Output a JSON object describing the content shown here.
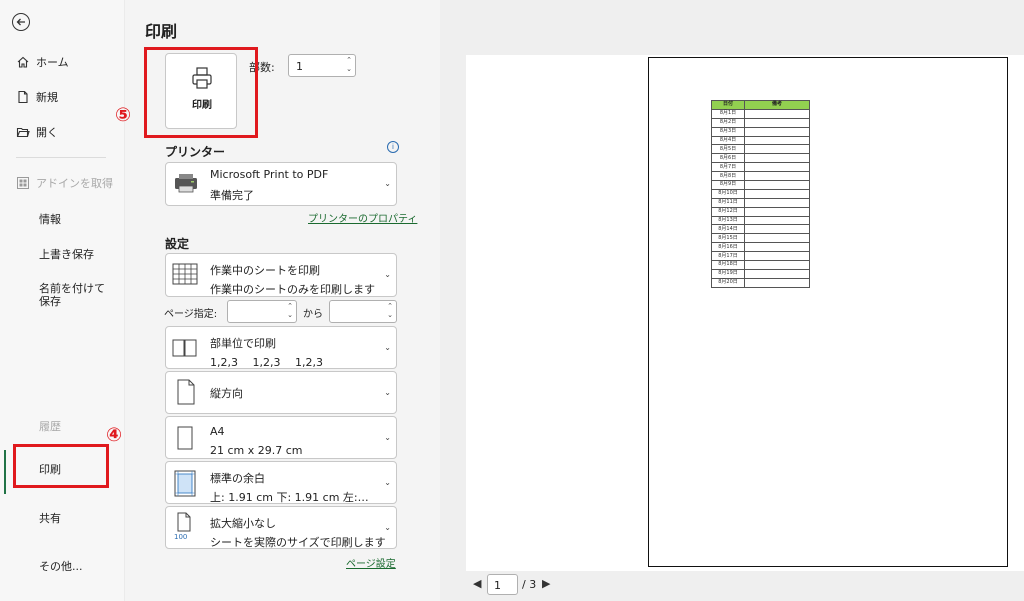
{
  "nav": {
    "home": "ホーム",
    "new": "新規",
    "open": "開く",
    "addins": "アドインを取得",
    "info": "情報",
    "save": "上書き保存",
    "save_as": "名前を付けて保存",
    "history": "履歴",
    "print": "印刷",
    "share": "共有",
    "more": "その他..."
  },
  "annotations": {
    "step4": "④",
    "step5": "⑤"
  },
  "page_title": "印刷",
  "print_button": {
    "label": "印刷"
  },
  "copies": {
    "label": "部数:",
    "value": "1"
  },
  "printer": {
    "section_title": "プリンター",
    "name": "Microsoft Print to PDF",
    "status": "準備完了",
    "properties_link": "プリンターのプロパティ"
  },
  "settings": {
    "section_title": "設定",
    "scope": {
      "line1": "作業中のシートを印刷",
      "line2": "作業中のシートのみを印刷します"
    },
    "pages": {
      "label": "ページ指定:",
      "to": "から",
      "from_value": "",
      "to_value": ""
    },
    "collate": {
      "line1": "部単位で印刷",
      "line2": "1,2,3　 1,2,3　 1,2,3"
    },
    "orientation": {
      "line1": "縦方向"
    },
    "paper": {
      "line1": "A4",
      "line2": "21 cm x 29.7 cm"
    },
    "margins": {
      "line1": "標準の余白",
      "line2": "上: 1.91 cm 下: 1.91 cm 左:…"
    },
    "scaling": {
      "line1": "拡大縮小なし",
      "line2": "シートを実際のサイズで印刷します",
      "icon_text": "100"
    },
    "page_setup_link": "ページ設定"
  },
  "preview": {
    "table_headers": [
      "日付",
      "備考"
    ],
    "dates": [
      "8月1日",
      "8月2日",
      "8月3日",
      "8月4日",
      "8月5日",
      "8月6日",
      "8月7日",
      "8月8日",
      "8月9日",
      "8月10日",
      "8月11日",
      "8月12日",
      "8月13日",
      "8月14日",
      "8月15日",
      "8月16日",
      "8月17日",
      "8月18日",
      "8月19日",
      "8月20日"
    ],
    "current_page": "1",
    "total_pages": "/ 3"
  },
  "colors": {
    "accent": "#217346",
    "highlight": "#e0191e",
    "header_fill": "#92d050"
  }
}
